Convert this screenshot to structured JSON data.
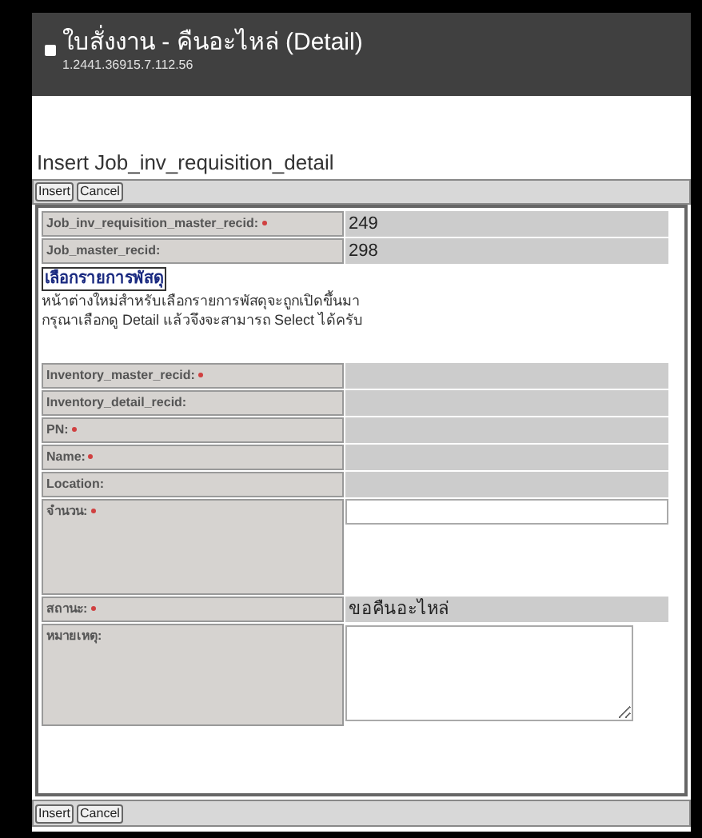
{
  "header": {
    "title": "ใบสั่งงาน - คืนอะไหล่ (Detail)",
    "subtitle": "1.2441.36915.7.112.56"
  },
  "form_title": "Insert Job_inv_requisition_detail",
  "top_buttons": [
    "Insert",
    "Cancel"
  ],
  "fields_top": [
    {
      "label": "Job_inv_requisition_master_recid:",
      "required": true,
      "kind": "readonly",
      "value": "249"
    },
    {
      "label": "Job_master_recid:",
      "required": false,
      "kind": "readonly",
      "value": "298"
    }
  ],
  "picker": {
    "link": "เลือกรายการพัสดุ",
    "lines": [
      "หน้าต่างใหม่สำหรับเลือกรายการพัสดุจะถูกเปิดขึ้นมา",
      "กรุณาเลือกดู Detail แล้วจึงจะสามารถ Select ได้ครับ"
    ]
  },
  "fields": [
    {
      "label": "Inventory_master_recid:",
      "required": true,
      "kind": "readonly"
    },
    {
      "label": "Inventory_detail_recid:",
      "required": false,
      "kind": "readonly"
    },
    {
      "label": "PN:",
      "required": true,
      "kind": "readonly"
    },
    {
      "label": "Name:",
      "required": true,
      "kind": "readonly"
    },
    {
      "label": "Location:",
      "required": false,
      "kind": "readonly"
    },
    {
      "label": "จำนวน:",
      "required": true,
      "kind": "input"
    },
    {
      "label": "สถานะ:",
      "required": true,
      "kind": "readonly",
      "value": "ขอคืนอะไหล่"
    },
    {
      "label": "หมายเหตุ:",
      "required": false,
      "kind": "textarea"
    }
  ],
  "bottom_buttons": [
    "Insert",
    "Cancel"
  ]
}
